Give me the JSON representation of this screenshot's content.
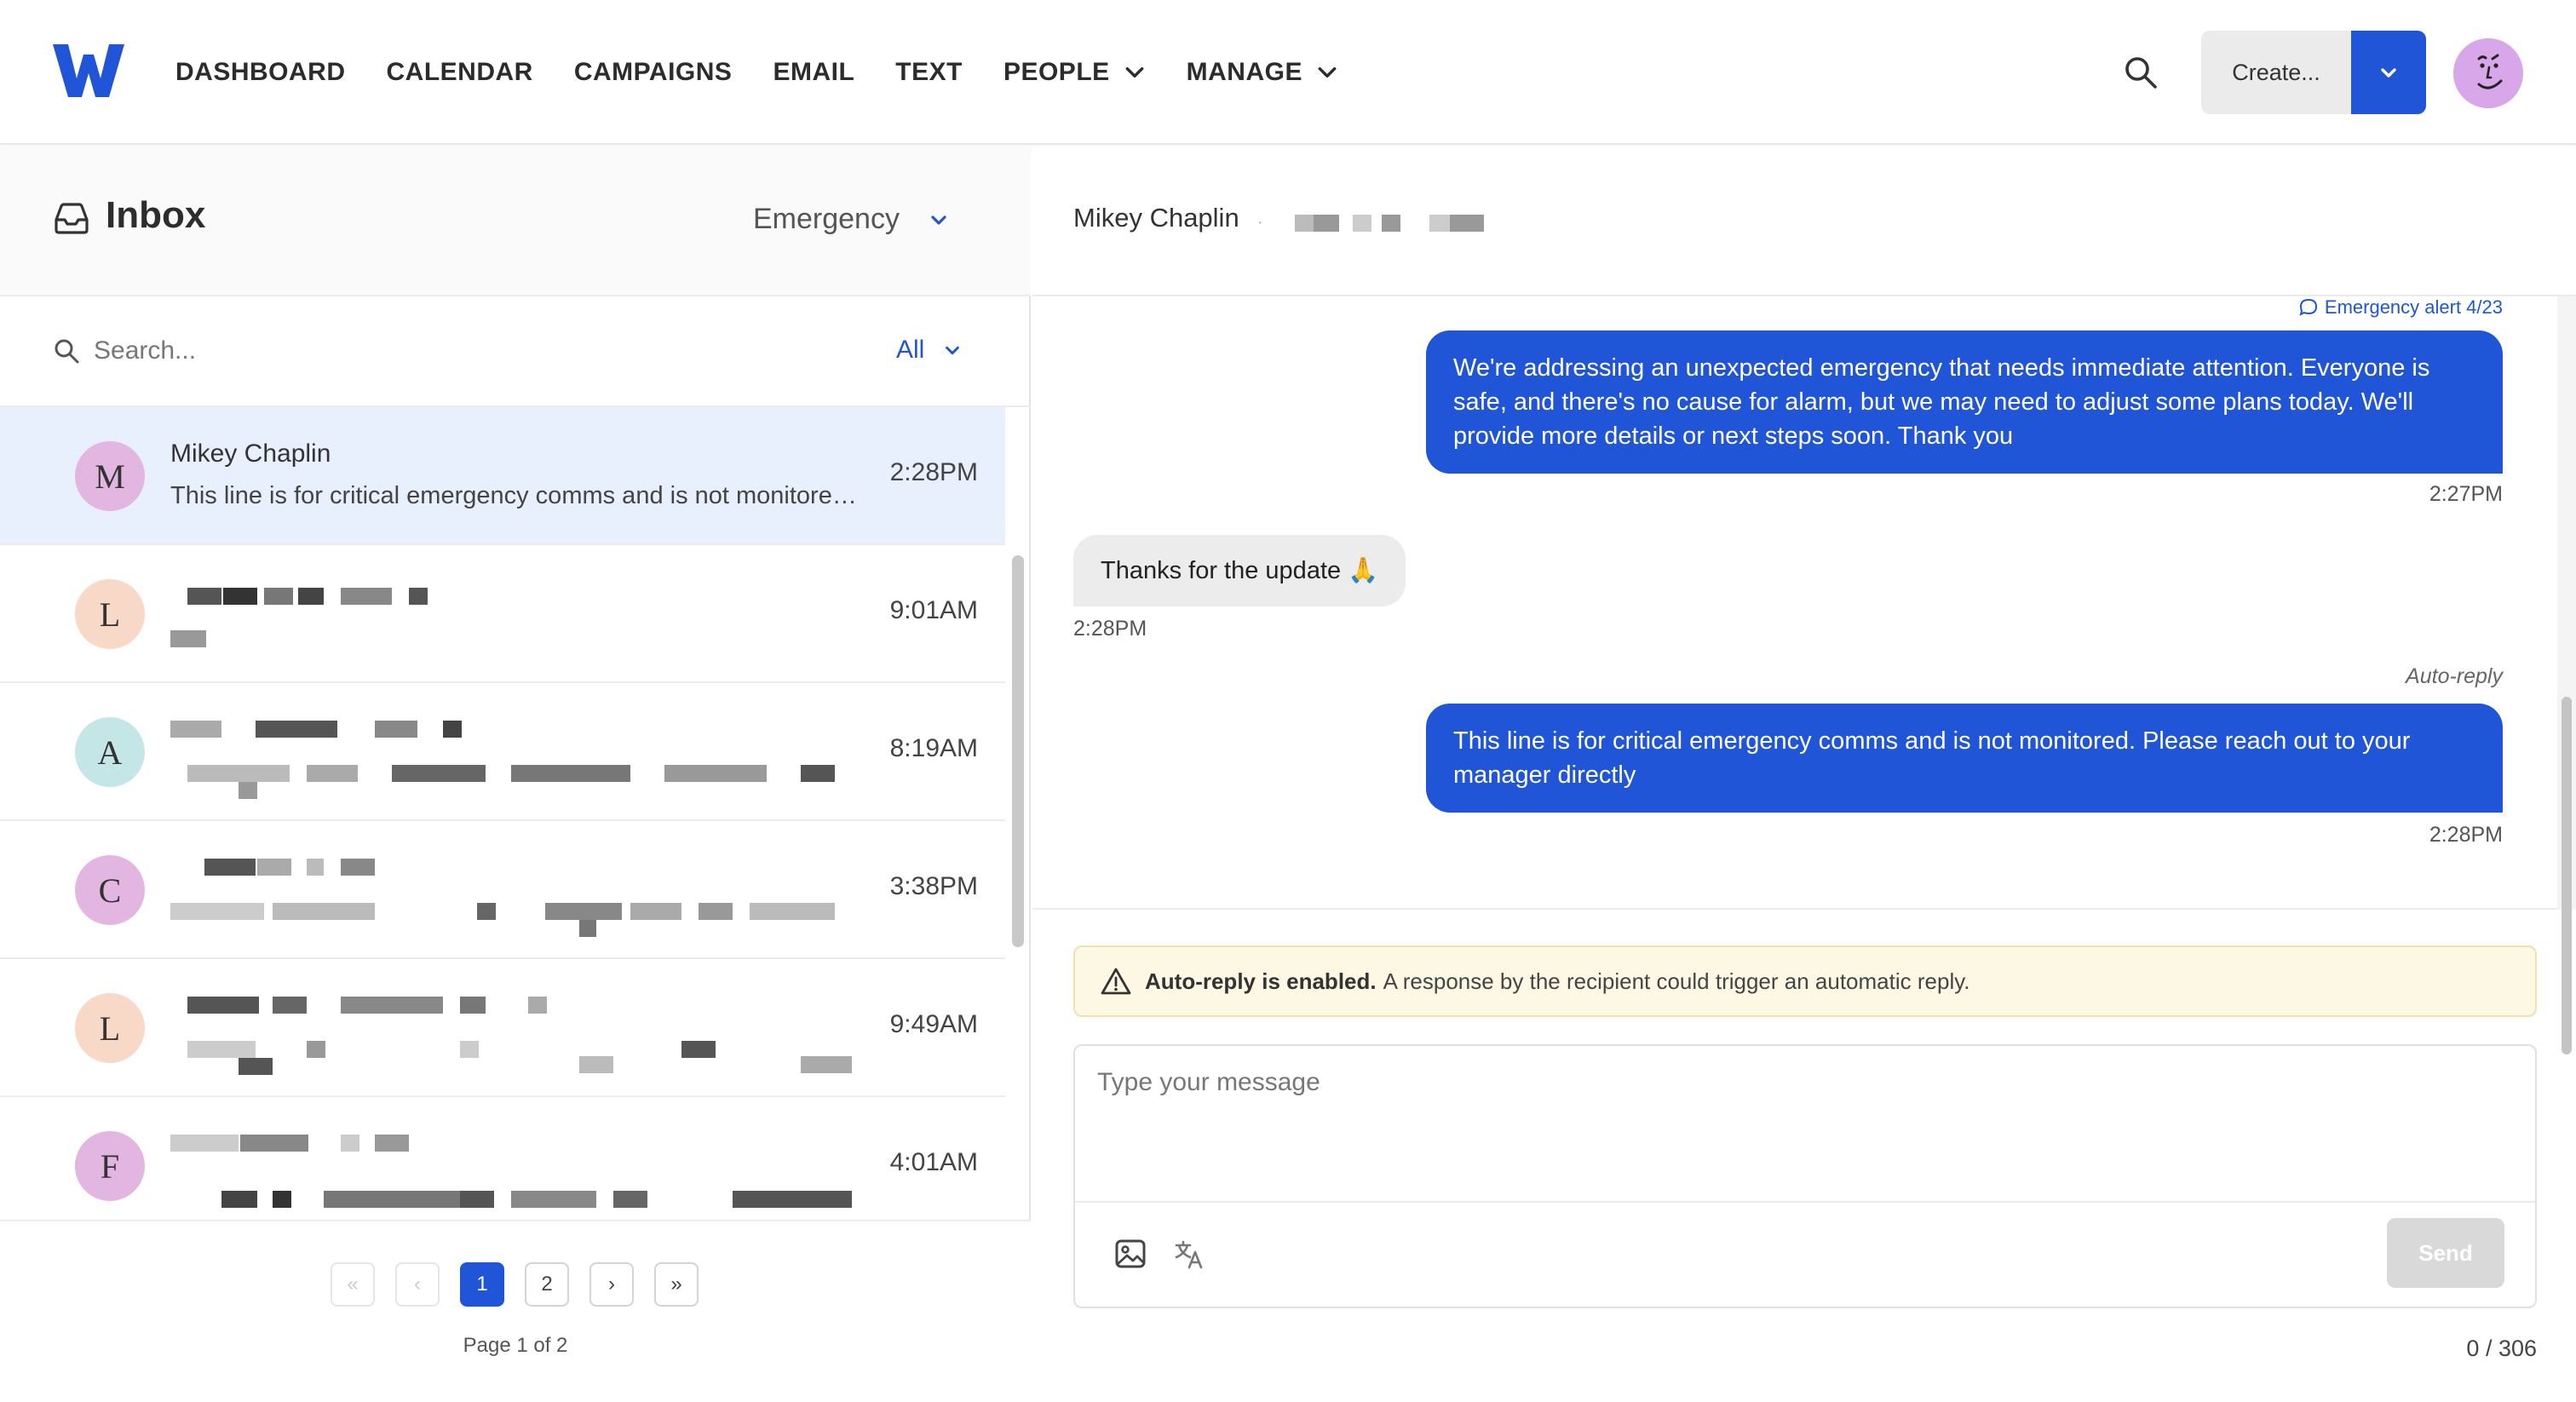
{
  "brand": {
    "accent": "#1f55d6"
  },
  "nav": {
    "items": [
      {
        "label": "DASHBOARD"
      },
      {
        "label": "CALENDAR"
      },
      {
        "label": "CAMPAIGNS"
      },
      {
        "label": "EMAIL"
      },
      {
        "label": "TEXT"
      },
      {
        "label": "PEOPLE",
        "dropdown": true
      },
      {
        "label": "MANAGE",
        "dropdown": true
      }
    ],
    "create_label": "Create..."
  },
  "inbox": {
    "title": "Inbox",
    "filter": "Emergency",
    "search_placeholder": "Search...",
    "scope": "All",
    "rows": [
      {
        "initial": "M",
        "name": "Mikey Chaplin",
        "preview": "This line is for critical emergency comms and is not monitored. Please reach out to your manager directly",
        "time": "2:28PM",
        "avatar_color": "#e2b6e0",
        "active": true
      },
      {
        "initial": "L",
        "name": "",
        "preview": "",
        "time": "9:01AM",
        "avatar_color": "#f8d8c6"
      },
      {
        "initial": "A",
        "name": "",
        "preview": "",
        "time": "8:19AM",
        "avatar_color": "#c4e6e6"
      },
      {
        "initial": "C",
        "name": "",
        "preview": "",
        "time": "3:38PM",
        "avatar_color": "#e2b6e0"
      },
      {
        "initial": "L",
        "name": "",
        "preview": "",
        "time": "9:49AM",
        "avatar_color": "#f8d8c6"
      },
      {
        "initial": "F",
        "name": "",
        "preview": "",
        "time": "4:01AM",
        "avatar_color": "#e2b6e0"
      }
    ],
    "pagination": {
      "first": "«",
      "prev": "‹",
      "pages": [
        "1",
        "2"
      ],
      "current": "1",
      "next": "›",
      "last": "»",
      "info": "Page 1 of 2"
    }
  },
  "conversation": {
    "contact_name": "Mikey Chaplin",
    "separator": "·",
    "alert_tag": "Emergency alert 4/23",
    "messages": [
      {
        "direction": "out",
        "text": "We're addressing an unexpected emergency that needs immediate attention. Everyone is safe, and there's no cause for alarm, but we may need to adjust some plans today. We'll provide more details or next steps soon. Thank you",
        "time": "2:27PM"
      },
      {
        "direction": "in",
        "text": "Thanks for the update 🙏",
        "time": "2:28PM"
      },
      {
        "direction": "out",
        "label": "Auto-reply",
        "text": "This line is for critical emergency comms and is not monitored. Please reach out to your manager directly",
        "time": "2:28PM"
      }
    ],
    "notice_bold": "Auto-reply is enabled.",
    "notice_text": "A response by the recipient could trigger an automatic reply.",
    "composer_placeholder": "Type your message",
    "send_label": "Send",
    "char_count": "0 / 306"
  }
}
